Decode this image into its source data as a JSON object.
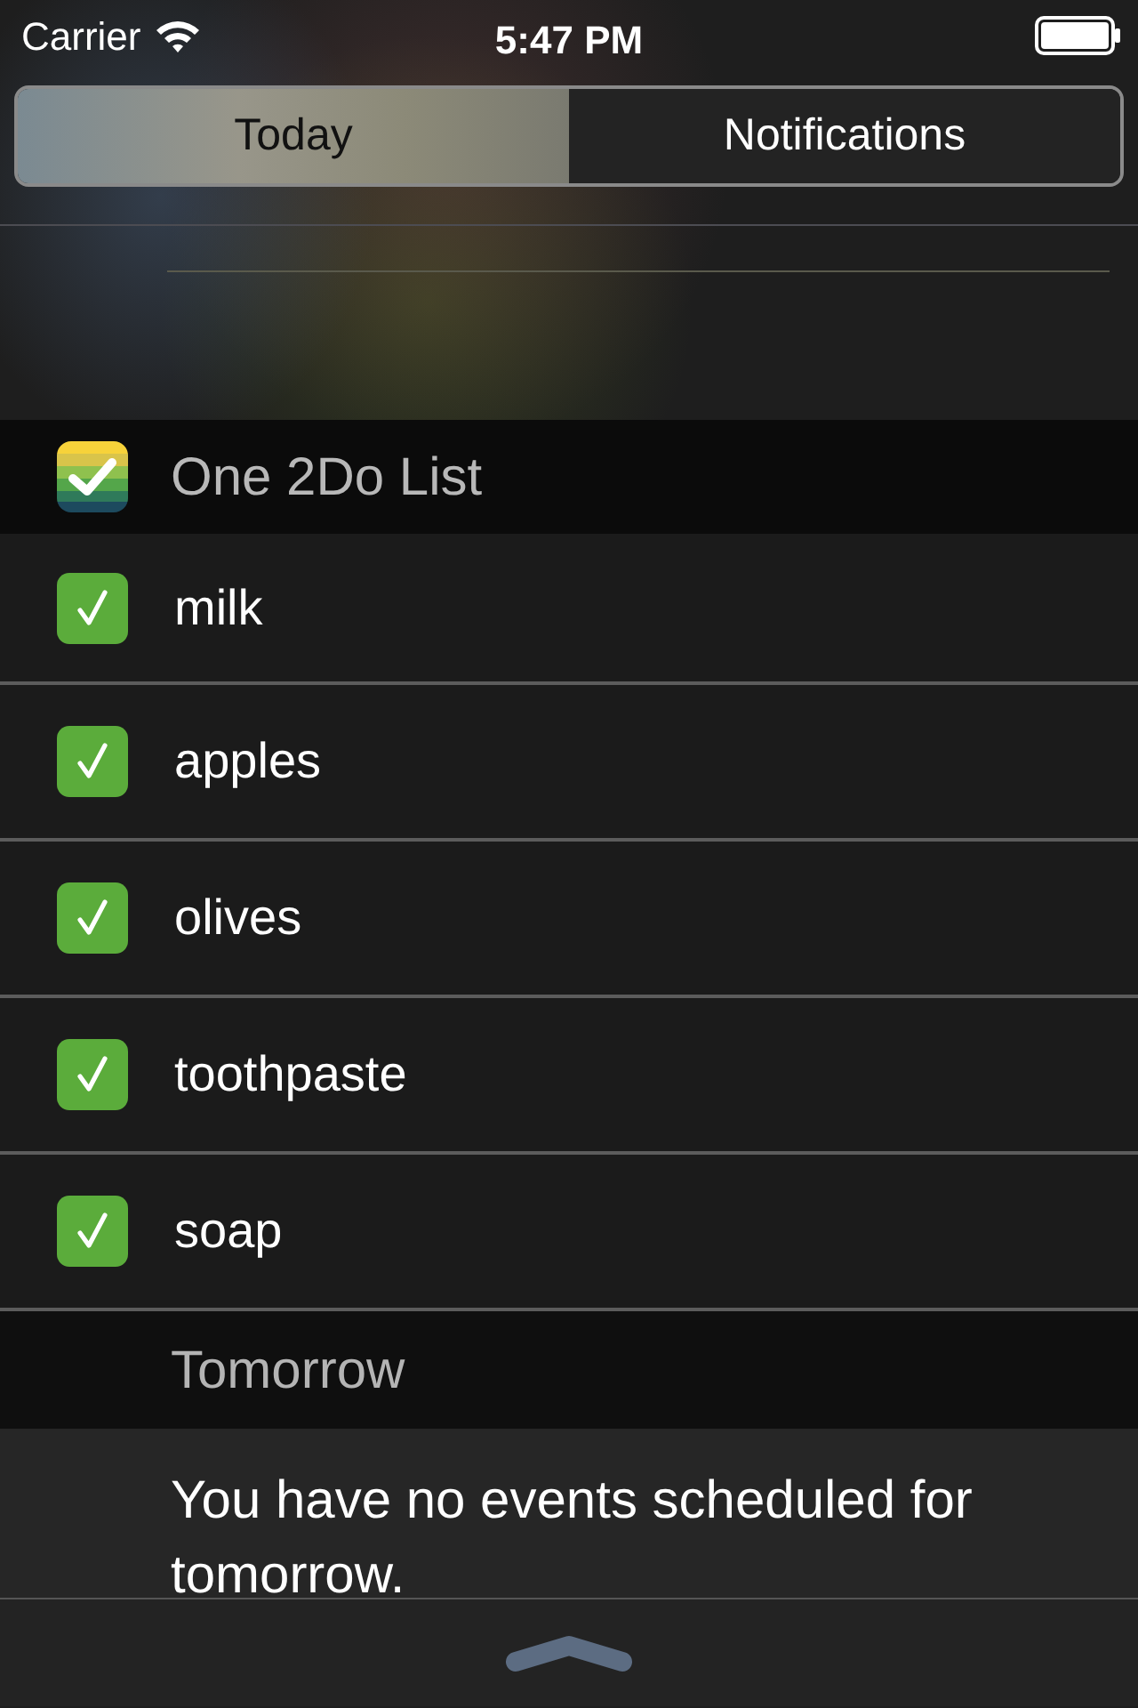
{
  "status_bar": {
    "carrier": "Carrier",
    "time": "5:47 PM"
  },
  "tabs": [
    {
      "label": "Today",
      "selected": true
    },
    {
      "label": "Notifications",
      "selected": false
    }
  ],
  "widget": {
    "title": "One 2Do List",
    "items": [
      {
        "label": "milk",
        "checked": true
      },
      {
        "label": "apples",
        "checked": true
      },
      {
        "label": "olives",
        "checked": true
      },
      {
        "label": "toothpaste",
        "checked": true
      },
      {
        "label": "soap",
        "checked": true
      }
    ]
  },
  "tomorrow": {
    "title": "Tomorrow",
    "message": "You have no events scheduled for tomorrow."
  }
}
